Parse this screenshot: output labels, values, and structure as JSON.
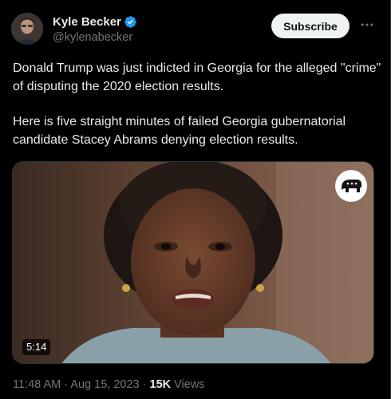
{
  "author": {
    "display_name": "Kyle Becker",
    "handle": "@kylenabecker",
    "verified": true,
    "avatar_icon": "avatar-photo"
  },
  "actions": {
    "subscribe_label": "Subscribe",
    "more_icon": "more-horizontal-icon"
  },
  "tweet": {
    "paragraphs": [
      "Donald Trump was just indicted in Georgia for the alleged \"crime\" of disputing the 2020 election results.",
      "Here is five straight minutes of failed Georgia gubernatorial candidate Stacey Abrams denying election results."
    ]
  },
  "media": {
    "type": "video",
    "duration": "5:14",
    "badge_icon": "gop-elephant-icon"
  },
  "meta": {
    "time": "11:48 AM",
    "separator": "·",
    "date": "Aug 15, 2023",
    "views_count": "15K",
    "views_label": "Views"
  },
  "colors": {
    "background": "#000000",
    "text_primary": "#e7e9ea",
    "text_secondary": "#71767b",
    "verified_blue": "#1d9bf0",
    "button_bg": "#eff3f4"
  }
}
